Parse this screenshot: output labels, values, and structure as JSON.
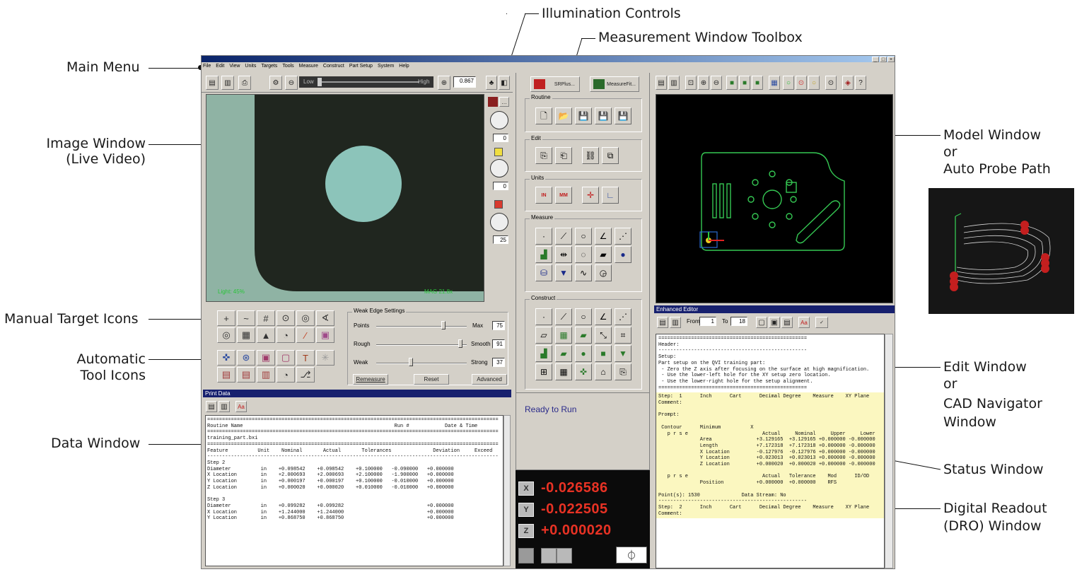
{
  "callouts": {
    "main_menu": "Main Menu",
    "image_window_1": "Image Window",
    "image_window_2": "(Live Video)",
    "manual_target_icons": "Manual Target Icons",
    "automatic_1": "Automatic",
    "automatic_2": "Tool Icons",
    "data_window": "Data Window",
    "illumination_controls": "Illumination Controls",
    "measurement_toolbox": "Measurement Window Toolbox",
    "model_window_1": "Model Window",
    "model_window_2": "or",
    "model_window_3": "Auto Probe Path",
    "edit_window_1": "Edit Window",
    "edit_window_2": "or",
    "edit_window_3": "CAD Navigator",
    "edit_window_4": "Window",
    "status_window": "Status Window",
    "dro_1": "Digital Readout",
    "dro_2": "(DRO) Window"
  },
  "app": {
    "menu": [
      "File",
      "Edit",
      "View",
      "Units",
      "Targets",
      "Tools",
      "Measure",
      "Construct",
      "Part Setup",
      "System",
      "Help"
    ],
    "window_buttons": [
      "_",
      "□",
      "×"
    ],
    "toolbar": {
      "low": "Low",
      "high": "High",
      "zoom_value": "0.867"
    },
    "illum_values": [
      "0",
      "0",
      "25"
    ],
    "image": {
      "light": "Light: 45%",
      "mag": "MAG 21.8x"
    },
    "weak_edge": {
      "title": "Weak Edge Settings",
      "points": "Points",
      "max": "Max",
      "max_val": "75",
      "rough": "Rough",
      "smooth": "Smooth",
      "smooth_val": "91",
      "weak": "Weak",
      "strong": "Strong",
      "strong_val": "37",
      "remeasure": "Remeasure",
      "reset": "Reset",
      "advanced": "Advanced"
    },
    "toolbox": {
      "srplus": "SRPlus...",
      "measurefit": "MeasureFit...",
      "routine": "Routine",
      "edit": "Edit",
      "units": "Units",
      "measure": "Measure",
      "construct": "Construct",
      "units_in": "IN",
      "units_mm": "MM"
    },
    "status": "Ready to Run",
    "dro": {
      "x_axis": "X",
      "y_axis": "Y",
      "z_axis": "Z",
      "x": "-0.026586",
      "y": "-0.022505",
      "z": "+0.000020"
    },
    "enhanced_editor": {
      "title": "Enhanced Editor",
      "from": "From",
      "from_val": "1",
      "to": "To",
      "to_val": "18"
    },
    "editor_lines": [
      "==================================================",
      "Header:",
      "--------------------------------------------------",
      "Setup:",
      "Part setup on the QVI training part:",
      " - Zero the Z axis after focusing on the surface at high magnification.",
      " - Use the lower-left hole for the XY setup zero location.",
      " - Use the lower-right hole for the setup alignment.",
      "=================================================="
    ],
    "editor_step_lines": [
      "Step:  1      Inch      Cart      Decimal Degree    Measure    XY Plane",
      "Comment:",
      "",
      "Prompt:",
      "",
      " Contour      Minimum          X",
      "   p r s e                         Actual     Nominal     Upper     Lower",
      "              Area               +3.129165  +3.129165 +0.000000 -0.000000",
      "              Length             +7.172318  +7.172318 +0.000000 -0.000000",
      "              X Location         -0.127976  -0.127976 +0.000000 -0.000000",
      "              Y Location         +0.023013  +0.023013 +0.000000 -0.000000",
      "              Z Location         +0.000020  +0.000020 +0.000000 -0.000000",
      "",
      "   p r s e                         Actual   Tolerance    Mod      ID/OD",
      "              Position           +0.000000  +0.000000    RFS",
      "",
      "Point(s): 1530              Data Stream: No",
      "--------------------------------------------------",
      "Step:  2      Inch      Cart      Decimal Degree    Measure    XY Plane",
      "Comment:"
    ],
    "print_data": {
      "title": "Print Data",
      "lines": [
        "==================================================================================================",
        "Routine Name                                                   Run #            Date & Time",
        "==================================================================================================",
        "training_part.bxi",
        "==================================================================================================",
        "Feature          Unit    Nominal       Actual       Tolerances              Deviation     Exceed",
        "--------------------------------------------------------------------------------------------------",
        "Step 2",
        "Diameter          in    +0.098542    +0.098542    +0.100000   -0.090000   +0.000000",
        "X Location        in    +2.000693    +2.000693    +2.100000   -1.900000   +0.000000",
        "Y Location        in    +0.000197    +0.000197    +0.100000   -0.010000   +0.000000",
        "Z Location        in    +0.000020    +0.000020    +0.010000   -0.010000   +0.000000",
        "",
        "Step 3",
        "Diameter          in    +0.099282    +0.099282                            +0.000000",
        "X Location        in    +1.244000    +1.244000                            +0.000000",
        "Y Location        in    +0.868750    +0.868750                            +0.000000"
      ]
    }
  },
  "colors": {
    "title_bar": "#17206e",
    "model_green": "#35c853",
    "dro_red": "#e83224",
    "status_blue": "#2a2a8a",
    "editor_yellow": "#fbf7c0"
  }
}
